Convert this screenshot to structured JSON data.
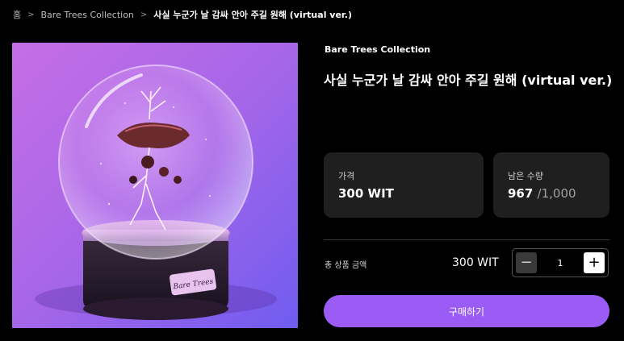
{
  "breadcrumb": {
    "home": "홈",
    "collection": "Bare Trees Collection",
    "current": "사실 누군가 날 감싸 안아 주길 원해 (virtual ver.)"
  },
  "product": {
    "collection": "Bare Trees Collection",
    "title": "사실 누군가 날 감싸 안아 주길 원해 (virtual ver.)",
    "price_label": "가격",
    "price_value": "300 WIT",
    "remaining_label": "남은 수량",
    "remaining_value": "967",
    "remaining_total": "/1,000"
  },
  "purchase": {
    "total_label": "총 상품 금액",
    "total_value": "300 WIT",
    "quantity": "1",
    "buy_label": "구매하기"
  },
  "artwork": {
    "icon": "snow-globe-artwork",
    "plate_text": "Bare Trees"
  },
  "colors": {
    "accent": "#9b5cf6",
    "card_bg": "#1f1f1f",
    "page_bg": "#000000"
  }
}
